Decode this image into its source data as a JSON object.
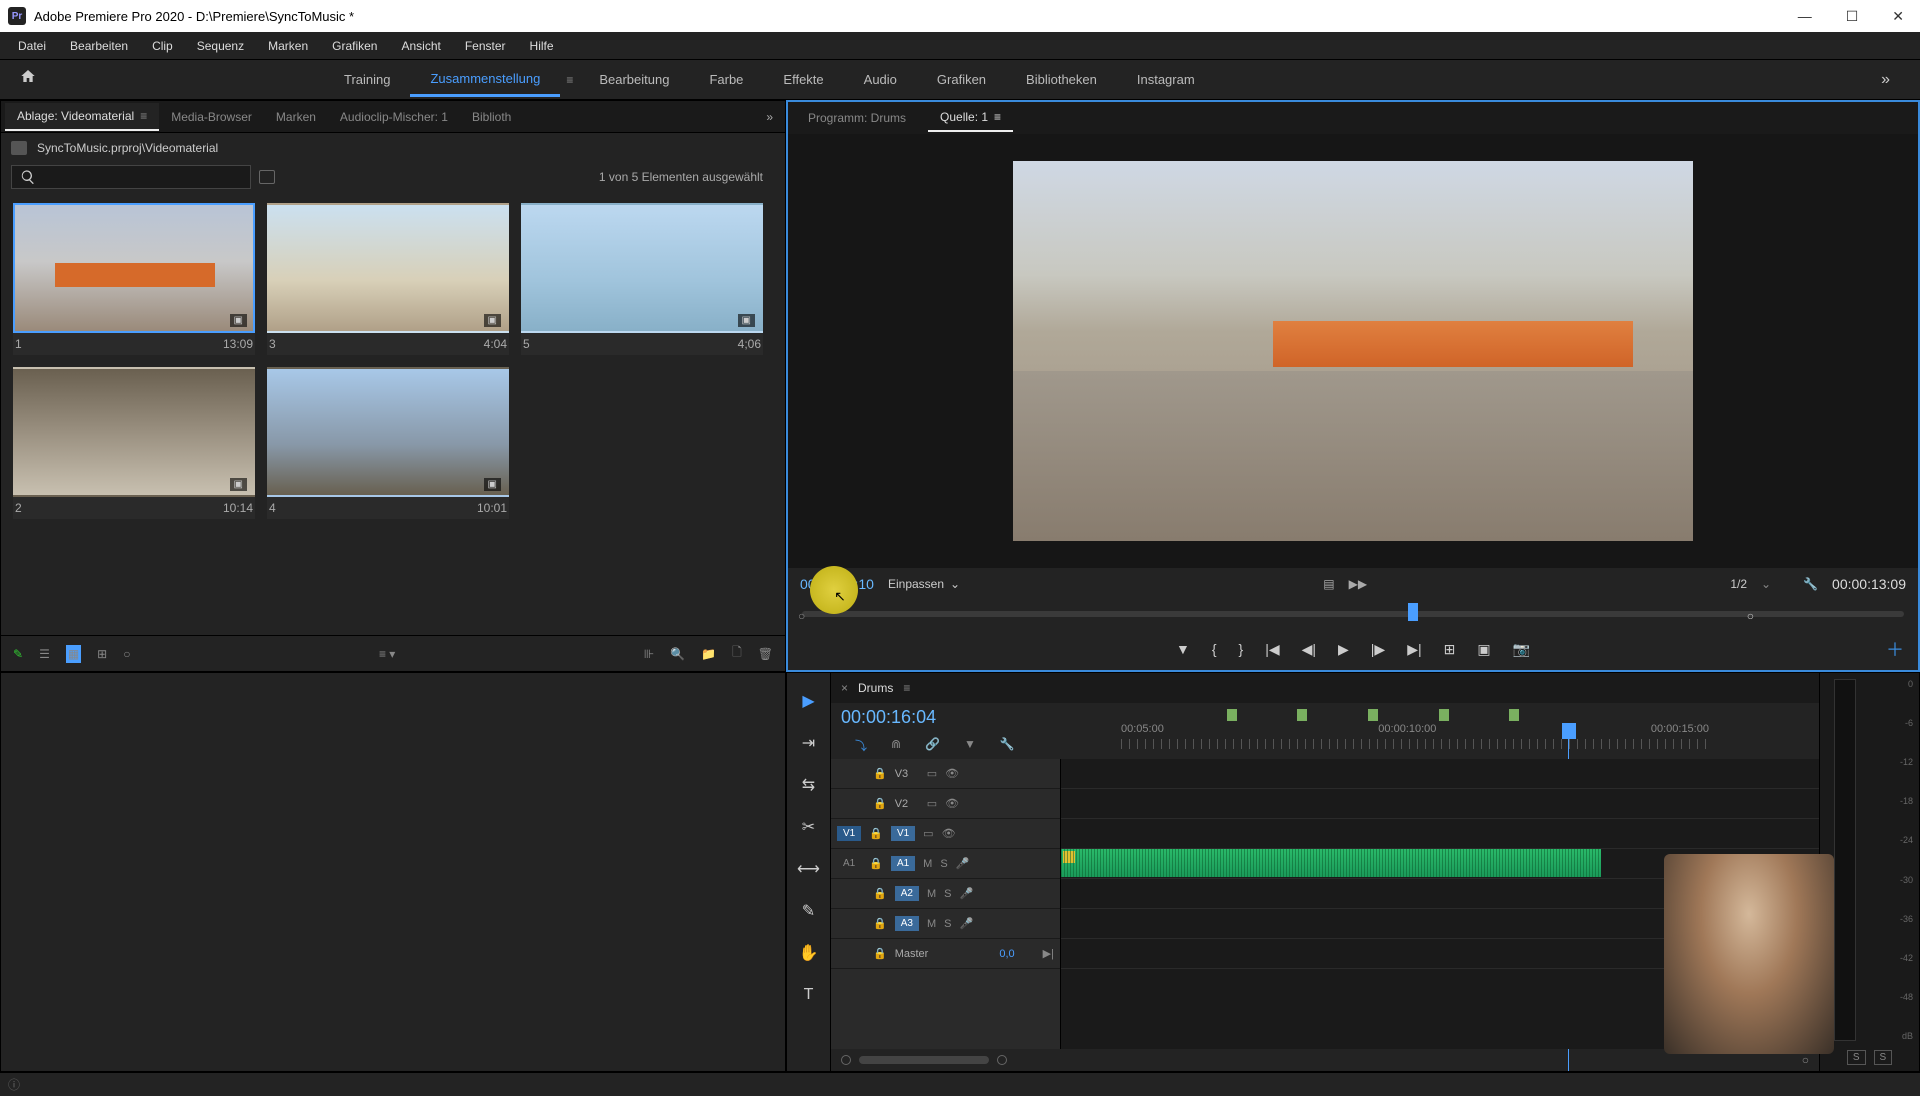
{
  "titlebar": {
    "app_icon": "Pr",
    "title": "Adobe Premiere Pro 2020 - D:\\Premiere\\SyncToMusic *"
  },
  "menu": [
    "Datei",
    "Bearbeiten",
    "Clip",
    "Sequenz",
    "Marken",
    "Grafiken",
    "Ansicht",
    "Fenster",
    "Hilfe"
  ],
  "workspaces": {
    "items": [
      "Training",
      "Zusammenstellung",
      "Bearbeitung",
      "Farbe",
      "Effekte",
      "Audio",
      "Grafiken",
      "Bibliotheken",
      "Instagram"
    ],
    "active": 1
  },
  "project_panel": {
    "tabs": [
      "Ablage: Videomaterial",
      "Media-Browser",
      "Marken",
      "Audioclip-Mischer: 1",
      "Biblioth"
    ],
    "active_tab": 0,
    "breadcrumb": "SyncToMusic.prproj\\Videomaterial",
    "selection_text": "1 von 5 Elementen ausgewählt",
    "clips": [
      {
        "name": "1",
        "dur": "13:09",
        "selected": true
      },
      {
        "name": "3",
        "dur": "4:04"
      },
      {
        "name": "5",
        "dur": "4;06"
      },
      {
        "name": "2",
        "dur": "10:14"
      },
      {
        "name": "4",
        "dur": "10:01"
      }
    ]
  },
  "monitor": {
    "tabs": [
      {
        "label": "Programm: Drums"
      },
      {
        "label": "Quelle: 1",
        "active": true
      }
    ],
    "tc_in": "00:00:06:10",
    "fit_label": "Einpassen",
    "zoom": "1/2",
    "duration": "00:00:13:09"
  },
  "timeline": {
    "sequence_name": "Drums",
    "tc": "00:00:16:04",
    "ruler": [
      "00:05:00",
      "00:00:10:00",
      "00:00:15:00"
    ],
    "tracks": {
      "v3": {
        "label": "V3"
      },
      "v2": {
        "label": "V2"
      },
      "v1": {
        "src": "V1",
        "label": "V1"
      },
      "a1": {
        "src": "A1",
        "label": "A1",
        "m": "M",
        "s": "S"
      },
      "a2": {
        "label": "A2",
        "m": "M",
        "s": "S"
      },
      "a3": {
        "label": "A3",
        "m": "M",
        "s": "S"
      },
      "master": {
        "label": "Master",
        "val": "0,0"
      }
    }
  },
  "meters": {
    "scale": [
      "0",
      "-6",
      "-12",
      "-18",
      "-24",
      "-30",
      "-36",
      "-42",
      "-48",
      "dB"
    ],
    "solo": "S"
  }
}
